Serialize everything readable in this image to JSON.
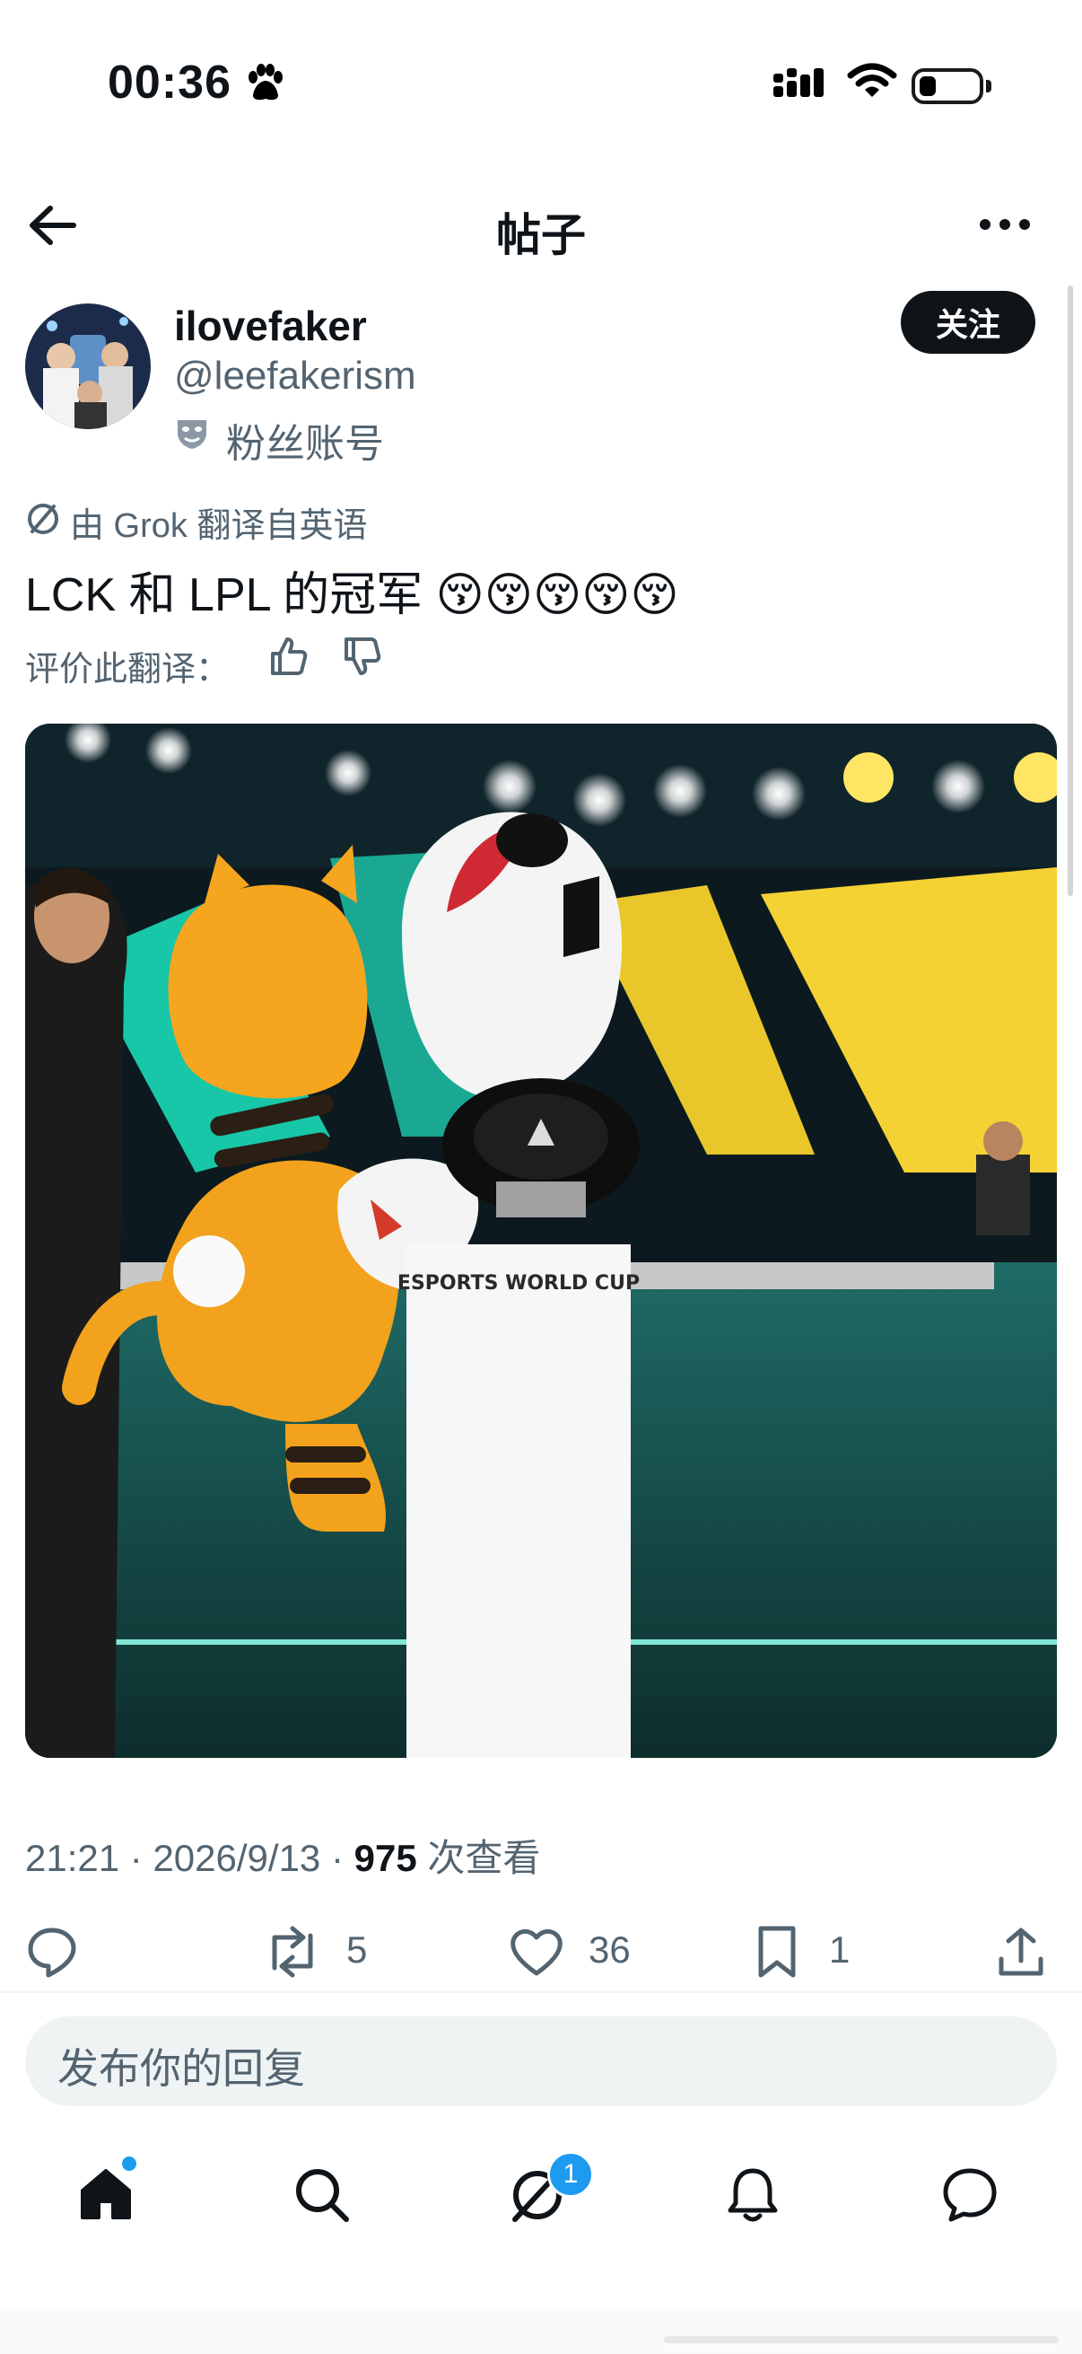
{
  "status_bar": {
    "time": "00:36",
    "battery_level": 0.2
  },
  "header": {
    "title": "帖子"
  },
  "author": {
    "name": "ilovefaker",
    "handle": "@leefakerism",
    "badge_label": "粉丝账号",
    "follow_label": "关注"
  },
  "translation": {
    "label": "由 Grok 翻译自英语",
    "text": "LCK 和 LPL 的冠军 😚😚😚😚😚",
    "rate_label": "评价此翻译："
  },
  "media": {
    "trophy_brand": "ESPORTS WORLD CUP"
  },
  "meta": {
    "time": "21:21",
    "date": "2026/9/13",
    "views": "975",
    "views_label": "次查看"
  },
  "actions": {
    "retweets": "5",
    "likes": "36",
    "bookmarks": "1"
  },
  "reply": {
    "placeholder": "发布你的回复"
  },
  "nav": {
    "messages_badge": "1"
  },
  "icons": {
    "back": "arrow-left-icon",
    "more": "more-horizontal-icon",
    "reply": "comment-icon",
    "retweet": "retweet-icon",
    "like": "heart-icon",
    "bookmark": "bookmark-icon",
    "share": "share-icon",
    "home": "home-icon",
    "search": "search-icon",
    "grok": "grok-icon",
    "notifications": "bell-icon",
    "messages": "chat-icon"
  },
  "colors": {
    "accent": "#1d9bf0",
    "text": "#0f1419",
    "secondary": "#536471"
  }
}
